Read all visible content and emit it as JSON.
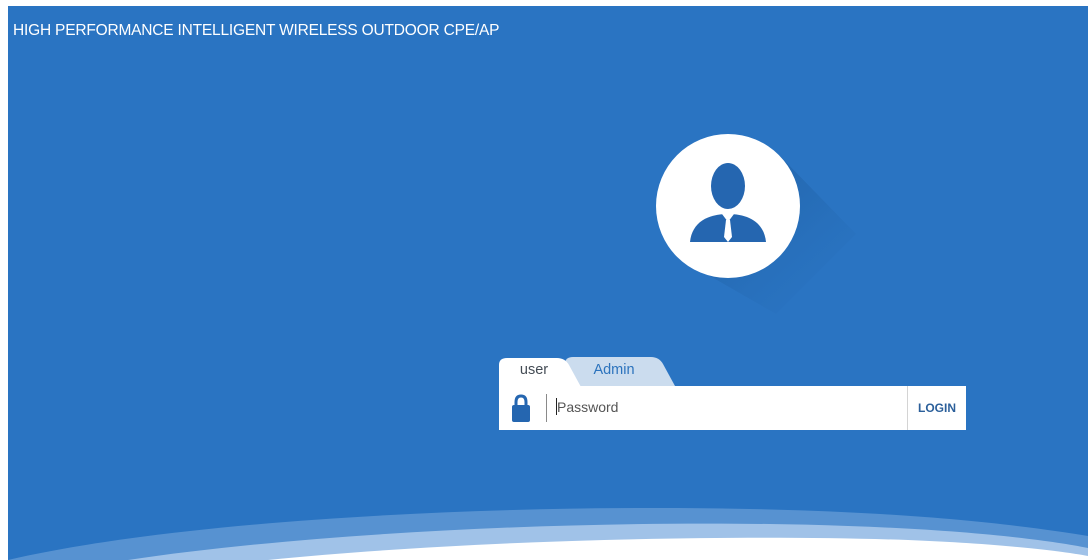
{
  "header": {
    "title": "HIGH PERFORMANCE INTELLIGENT WIRELESS OUTDOOR CPE/AP"
  },
  "avatar": {
    "icon": "user-avatar-icon"
  },
  "login": {
    "tabs": [
      {
        "label": "user",
        "active": true
      },
      {
        "label": "Admin",
        "active": false
      }
    ],
    "password": {
      "value": "",
      "placeholder": "Password",
      "icon": "lock-icon"
    },
    "submit_label": "LOGIN"
  },
  "colors": {
    "background": "#2a74c2",
    "avatar_figure": "#2566b0",
    "active_tab": "#ffffff",
    "inactive_tab": "#cbdcee",
    "login_text": "#2b5f9a"
  }
}
